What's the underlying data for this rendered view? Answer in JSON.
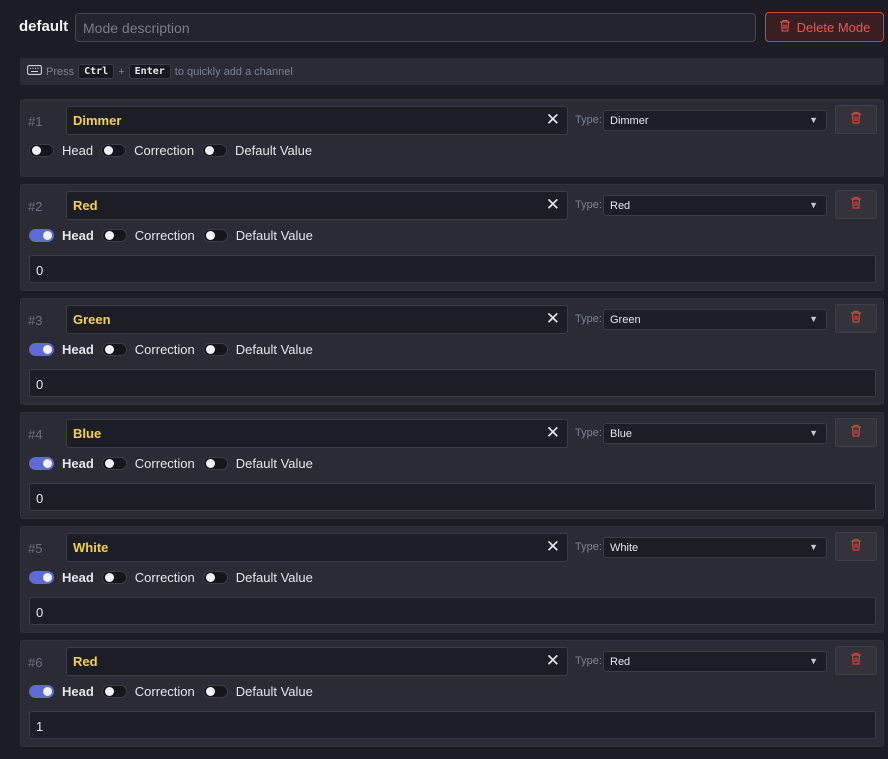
{
  "mode": {
    "name": "default",
    "description_placeholder": "Mode description",
    "description_value": "",
    "delete_label": "Delete Mode"
  },
  "hint": {
    "press": "Press",
    "key1": "Ctrl",
    "plus": "+",
    "key2": "Enter",
    "suffix": "to quickly add a channel"
  },
  "labels": {
    "type": "Type:",
    "head": "Head",
    "correction": "Correction",
    "default_value": "Default Value"
  },
  "channels": [
    {
      "num": "#1",
      "name": "Dimmer",
      "type": "Dimmer",
      "head": false,
      "correction": false,
      "default_value_on": false,
      "value": null
    },
    {
      "num": "#2",
      "name": "Red",
      "type": "Red",
      "head": true,
      "correction": false,
      "default_value_on": false,
      "value": "0"
    },
    {
      "num": "#3",
      "name": "Green",
      "type": "Green",
      "head": true,
      "correction": false,
      "default_value_on": false,
      "value": "0"
    },
    {
      "num": "#4",
      "name": "Blue",
      "type": "Blue",
      "head": true,
      "correction": false,
      "default_value_on": false,
      "value": "0"
    },
    {
      "num": "#5",
      "name": "White",
      "type": "White",
      "head": true,
      "correction": false,
      "default_value_on": false,
      "value": "0"
    },
    {
      "num": "#6",
      "name": "Red",
      "type": "Red",
      "head": true,
      "correction": false,
      "default_value_on": false,
      "value": "1"
    }
  ],
  "colors": {
    "background": "#1c1d24",
    "panel": "#2a2b34",
    "accent_toggle": "#5c6bd6",
    "channel_name": "#f5d33c",
    "danger": "#ef5350"
  },
  "icons": {
    "delete": "trash-icon",
    "clear": "close-icon",
    "select": "chevron-down-icon",
    "keyboard": "keyboard-icon"
  }
}
